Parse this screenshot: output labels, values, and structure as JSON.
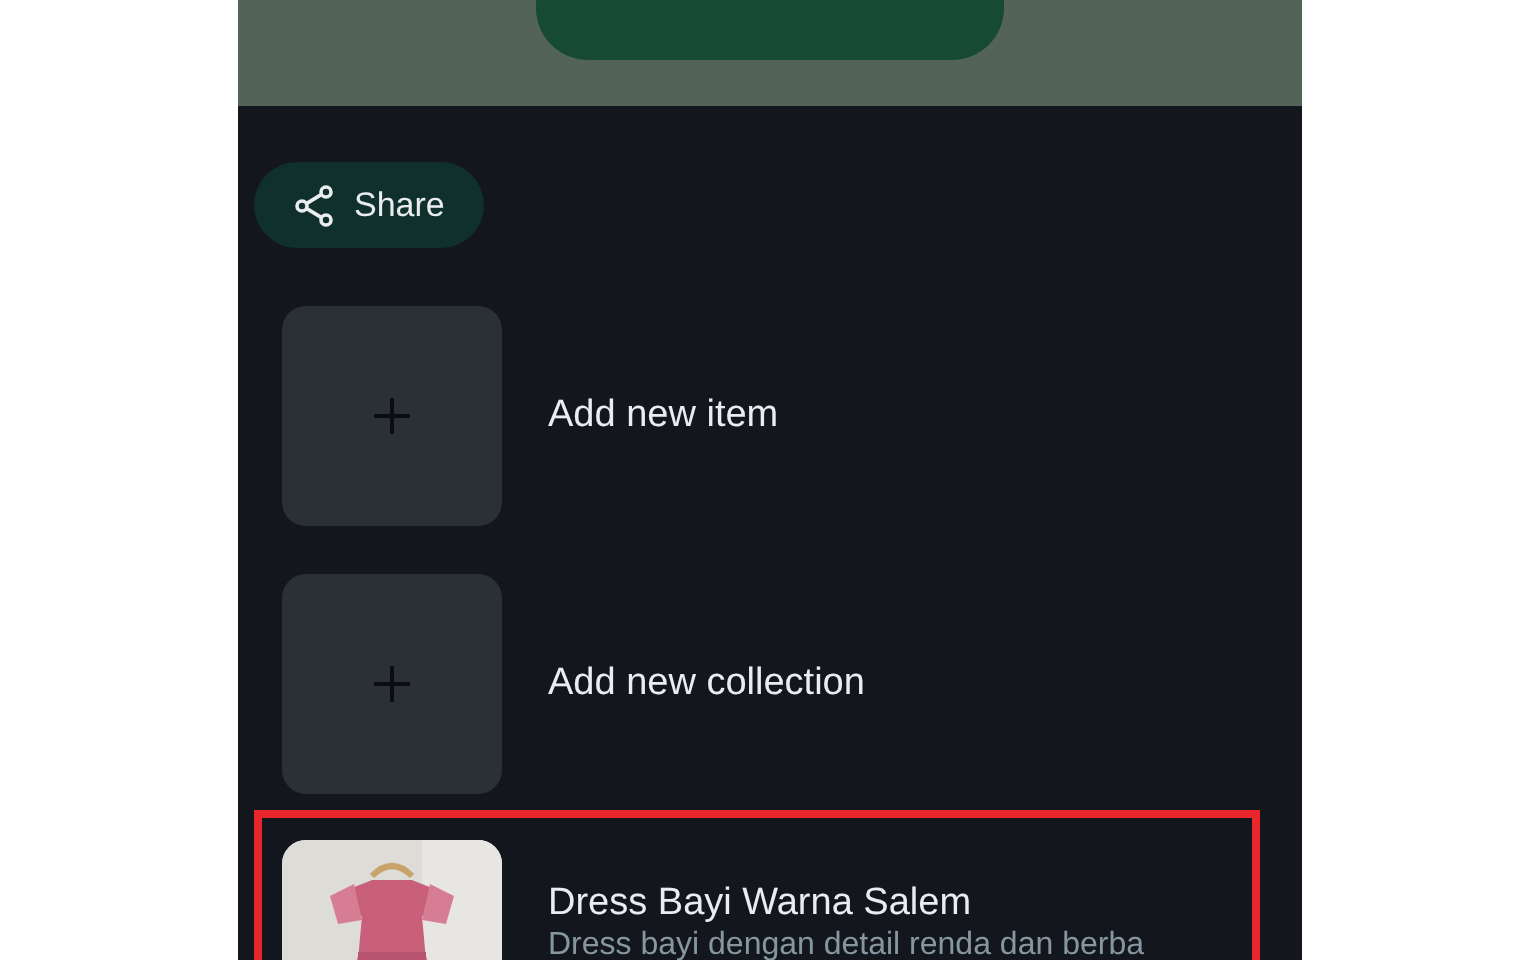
{
  "share_button": {
    "label": "Share"
  },
  "items": [
    {
      "kind": "add",
      "label": "Add new item"
    },
    {
      "kind": "add",
      "label": "Add new collection"
    },
    {
      "kind": "product",
      "title": "Dress Bayi Warna Salem",
      "description": "Dress bayi dengan detail renda dan berba",
      "highlighted": true
    }
  ]
}
